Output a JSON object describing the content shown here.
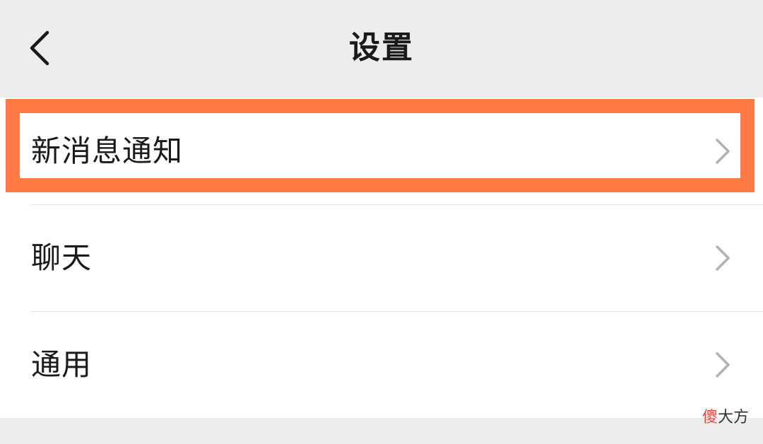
{
  "header": {
    "title": "设置",
    "back_icon": "chevron-left-icon"
  },
  "menu": {
    "items": [
      {
        "label": "新消息通知",
        "icon": "chevron-right-icon",
        "highlighted": true
      },
      {
        "label": "聊天",
        "icon": "chevron-right-icon",
        "highlighted": false
      },
      {
        "label": "通用",
        "icon": "chevron-right-icon",
        "highlighted": false
      }
    ]
  },
  "highlight": {
    "color": "#ff7a45"
  },
  "watermark": {
    "accent": "傻",
    "rest": "大方"
  },
  "colors": {
    "background": "#ededed",
    "panel": "#ffffff",
    "text": "#191919",
    "chevron": "#b2b2b2",
    "highlight": "#ff7a45"
  }
}
